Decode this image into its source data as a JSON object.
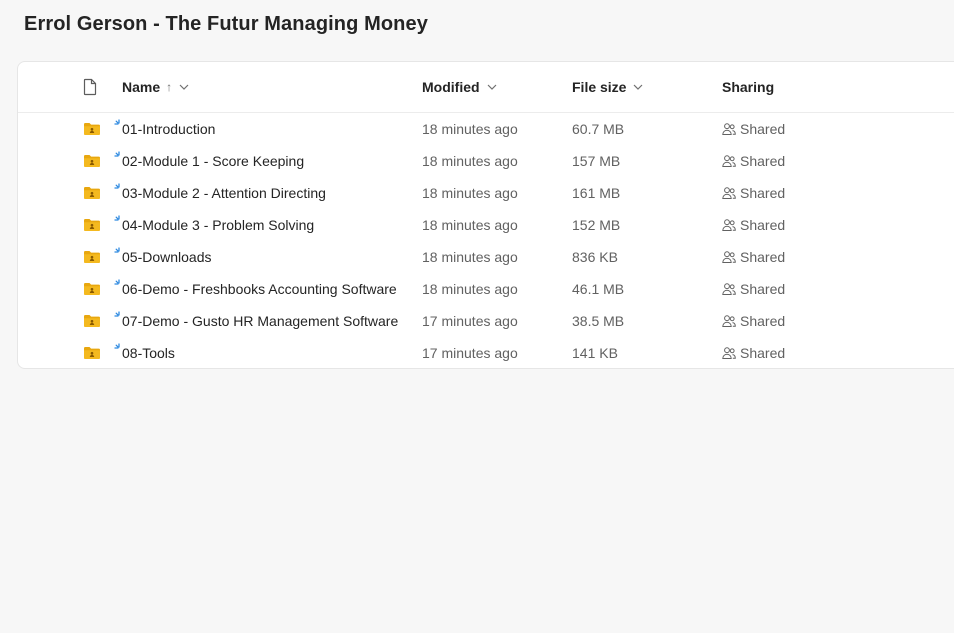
{
  "page": {
    "title": "Errol Gerson - The Futur Managing Money"
  },
  "columns": {
    "name": "Name",
    "modified": "Modified",
    "file_size": "File size",
    "sharing": "Sharing",
    "sort_indicator": "↑"
  },
  "files": [
    {
      "name": "01-Introduction",
      "modified": "18 minutes ago",
      "size": "60.7 MB",
      "sharing": "Shared"
    },
    {
      "name": "02-Module 1 - Score Keeping",
      "modified": "18 minutes ago",
      "size": "157 MB",
      "sharing": "Shared"
    },
    {
      "name": "03-Module 2 - Attention Directing",
      "modified": "18 minutes ago",
      "size": "161 MB",
      "sharing": "Shared"
    },
    {
      "name": "04-Module 3 - Problem Solving",
      "modified": "18 minutes ago",
      "size": "152 MB",
      "sharing": "Shared"
    },
    {
      "name": "05-Downloads",
      "modified": "18 minutes ago",
      "size": "836 KB",
      "sharing": "Shared"
    },
    {
      "name": "06-Demo - Freshbooks Accounting Software",
      "modified": "18 minutes ago",
      "size": "46.1 MB",
      "sharing": "Shared"
    },
    {
      "name": "07-Demo - Gusto HR Management Software",
      "modified": "17 minutes ago",
      "size": "38.5 MB",
      "sharing": "Shared"
    },
    {
      "name": "08-Tools",
      "modified": "17 minutes ago",
      "size": "141 KB",
      "sharing": "Shared"
    }
  ],
  "icons": {
    "file_type": "document-icon",
    "folder": "shared-folder-icon",
    "sync": "new-item-sparkle-icon",
    "sharing": "people-icon",
    "chevron": "chevron-down-icon"
  },
  "colors": {
    "folder": "#f4b91f",
    "folder_dark": "#e8a70f",
    "sync": "#2f8ae0",
    "text": "#242424",
    "muted": "#616161"
  }
}
